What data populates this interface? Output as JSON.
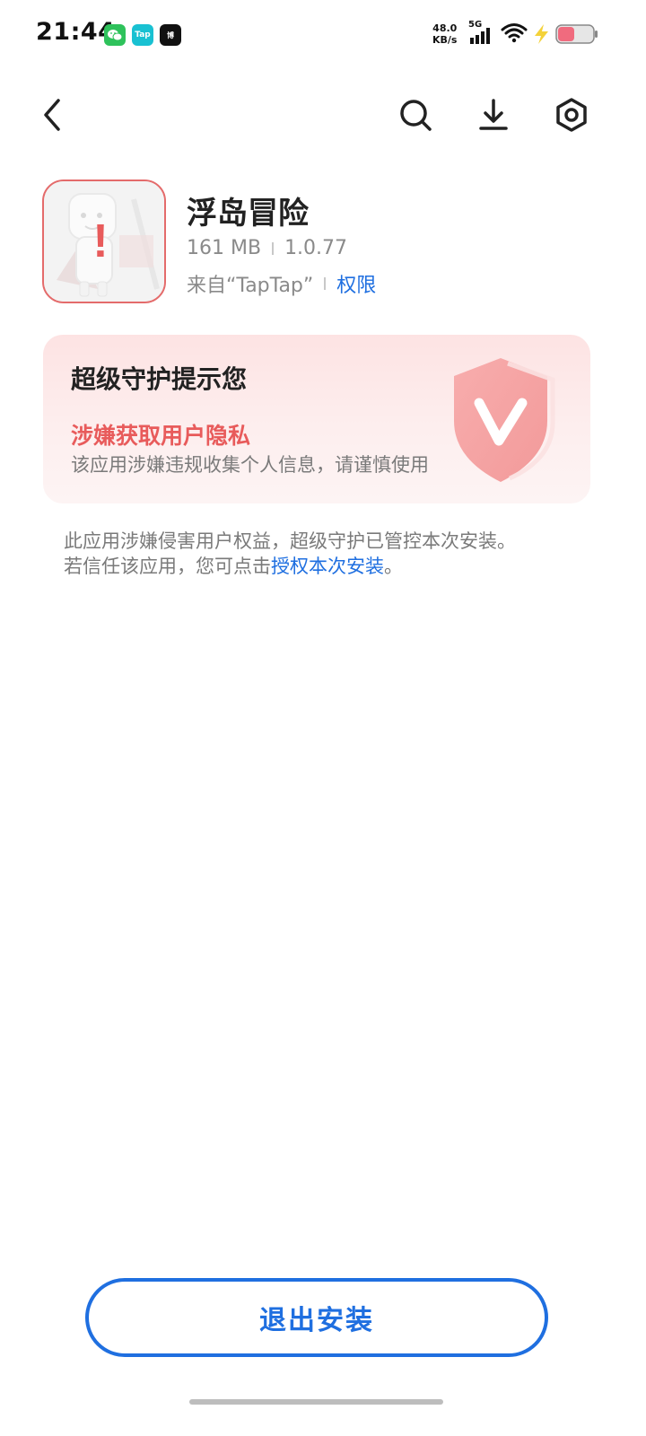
{
  "status_bar": {
    "time": "21:44",
    "badges": [
      "Tap",
      "博"
    ],
    "net_speed_value": "48.0",
    "net_speed_unit": "KB/s",
    "network_type": "5G",
    "battery_color": "#f06b7e"
  },
  "app": {
    "name": "浮岛冒险",
    "size": "161 MB",
    "version": "1.0.77",
    "source": "来自“TapTap”",
    "permissions_link": "权限",
    "alert_mark": "!"
  },
  "warning": {
    "title": "超级守护提示您",
    "reason": "涉嫌获取用户隐私",
    "description": "该应用涉嫌违规收集个人信息，请谨慎使用"
  },
  "notice": {
    "line1": "此应用涉嫌侵害用户权益，超级守护已管控本次安装。",
    "line2_prefix": "若信任该应用，您可点击",
    "authorize_link": "授权本次安装",
    "line2_suffix": "。"
  },
  "bottom": {
    "exit_label": "退出安装"
  },
  "colors": {
    "accent_blue": "#1f6fe0",
    "warning_red": "#e85b5b"
  }
}
